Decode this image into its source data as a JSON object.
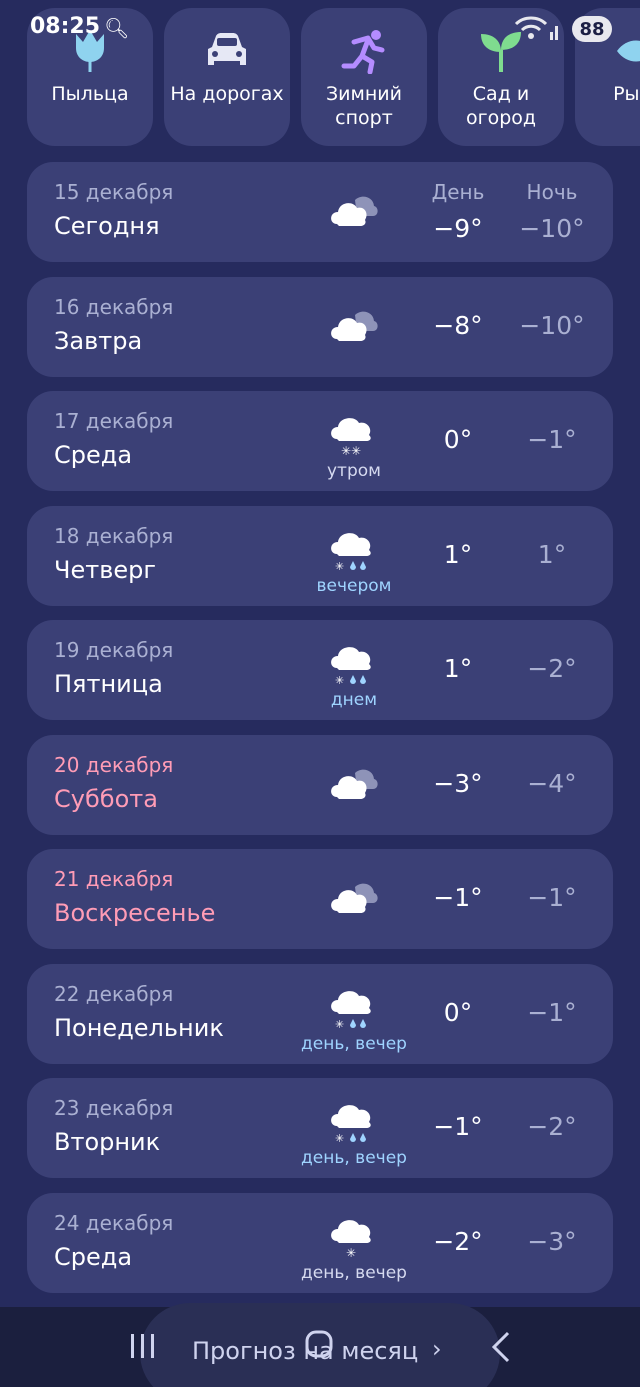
{
  "status_bar": {
    "time": "08:25",
    "battery": "88"
  },
  "categories": [
    {
      "label": "Пыльца",
      "icon": "tulip-icon"
    },
    {
      "label": "На дорогах",
      "icon": "car-icon"
    },
    {
      "label": "Зимний\nспорт",
      "icon": "runner-icon"
    },
    {
      "label": "Сад и\nогород",
      "icon": "sprout-icon"
    },
    {
      "label": "Рыба",
      "icon": "fish-icon"
    }
  ],
  "headers": {
    "day": "День",
    "night": "Ночь"
  },
  "days": [
    {
      "date": "15 декабря",
      "name": "Сегодня",
      "icon": "partly-cloudy-icon",
      "note": "",
      "day_temp": "−9°",
      "night_temp": "−10°"
    },
    {
      "date": "16 декабря",
      "name": "Завтра",
      "icon": "partly-cloudy-icon",
      "note": "",
      "day_temp": "−8°",
      "night_temp": "−10°"
    },
    {
      "date": "17 декабря",
      "name": "Среда",
      "icon": "snow-icon",
      "note": "утром",
      "day_temp": "0°",
      "night_temp": "−1°"
    },
    {
      "date": "18 декабря",
      "name": "Четверг",
      "icon": "sleet-icon",
      "note": "вечером",
      "day_temp": "1°",
      "night_temp": "1°"
    },
    {
      "date": "19 декабря",
      "name": "Пятница",
      "icon": "sleet-icon",
      "note": "днем",
      "day_temp": "1°",
      "night_temp": "−2°"
    },
    {
      "date": "20 декабря",
      "name": "Суббота",
      "icon": "partly-cloudy-icon",
      "note": "",
      "day_temp": "−3°",
      "night_temp": "−4°"
    },
    {
      "date": "21 декабря",
      "name": "Воскресенье",
      "icon": "partly-cloudy-icon",
      "note": "",
      "day_temp": "−1°",
      "night_temp": "−1°"
    },
    {
      "date": "22 декабря",
      "name": "Понедельник",
      "icon": "sleet-icon",
      "note": "день, вечер",
      "day_temp": "0°",
      "night_temp": "−1°"
    },
    {
      "date": "23 декабря",
      "name": "Вторник",
      "icon": "sleet-icon",
      "note": "день, вечер",
      "day_temp": "−1°",
      "night_temp": "−2°"
    },
    {
      "date": "24 декабря",
      "name": "Среда",
      "icon": "light-snow-icon",
      "note": "день, вечер",
      "day_temp": "−2°",
      "night_temp": "−3°"
    }
  ],
  "bottom": {
    "month_forecast": "Прогноз на месяц"
  }
}
